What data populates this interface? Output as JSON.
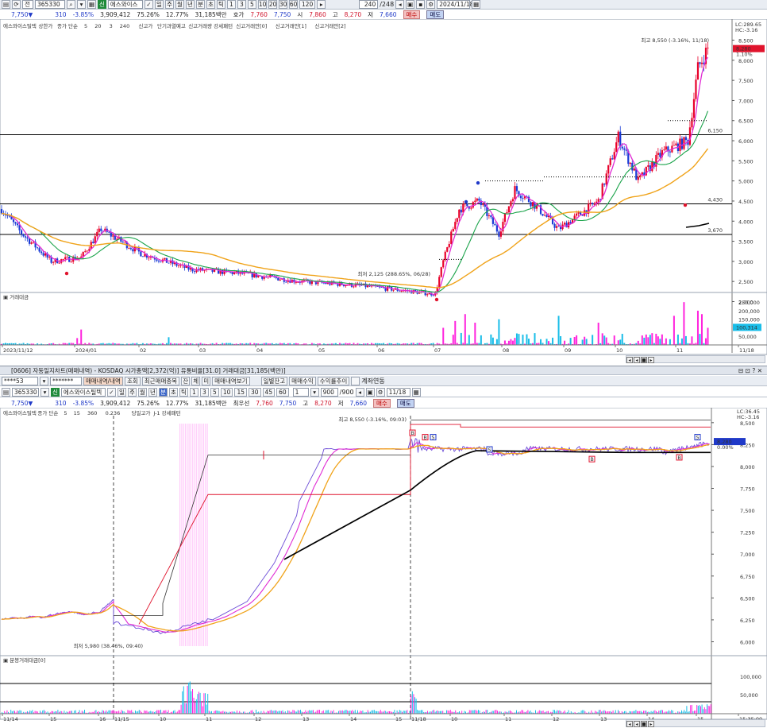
{
  "top": {
    "toolbar": {
      "code": "365330",
      "flag": "전",
      "name": "에스와이스",
      "chk": "주",
      "periods": [
        "일",
        "주",
        "월",
        "년",
        "분",
        "초",
        "틱"
      ],
      "nums": [
        "1",
        "3",
        "5",
        "10",
        "20",
        "30",
        "60",
        "120"
      ],
      "count": "240",
      "total": "/248",
      "date": "2024/11/18"
    },
    "quote": {
      "price": "7,750▼",
      "change": "310",
      "pct": "-3.85%",
      "volume": "3,909,412",
      "ratio": "75.26%",
      "turn": "12.77%",
      "amount": "31,185백만",
      "ask_label": "호가",
      "ask": "7,760",
      "bid": "7,750",
      "high_label": "시",
      "open": "7,860",
      "hi_label": "고",
      "high": "8,270",
      "lo_label": "저",
      "low": "7,660",
      "buy": "매수",
      "sell": "매도"
    },
    "legend": [
      "에스와이스틸텍",
      "상한가",
      "종가 단순",
      "5",
      "20",
      "3",
      "240",
      "신고가",
      "단기과열예고",
      "신고거래량 강세패턴",
      "신고거래안[0]",
      "신고거래안[1]",
      "신고거래안[2]"
    ],
    "price_axis": [
      "8,500",
      "8,000",
      "7,500",
      "7,000",
      "6,500",
      "6,000",
      "5,500",
      "5,000",
      "4,500",
      "4,000",
      "3,500",
      "3,000",
      "2,500",
      "2,000"
    ],
    "levels": [
      "6,150",
      "4,430",
      "3,670"
    ],
    "axis_head": "LC:289.65\nHC:-3.16",
    "current_tag": "8,280",
    "current_sub": "1.10%",
    "high_note": "최고 8,550 (-3.16%, 11/18)",
    "low_note": "최저 2,125 (288.65%, 06/28)",
    "vol_title": "거래대금",
    "vol_axis": [
      "250,000",
      "200,000",
      "150,000",
      "100,000",
      "50,000"
    ],
    "vol_tag": "100,314",
    "dates": [
      "2023/11/12",
      "2024/01",
      "02",
      "03",
      "04",
      "05",
      "06",
      "07",
      "08",
      "09",
      "10",
      "11",
      "11/18"
    ]
  },
  "bottom": {
    "title": "[0606] 자동일지차트(매매내역) - KOSDAQ 시가총액[2,372(억)] 유통비율[31.0] 거래대금[31,185(백만)]",
    "toolbar": {
      "code": "365330",
      "tag": "신",
      "name": "에스와이스틸텍",
      "btn1": "매매내역/내역",
      "btn2": "조회",
      "btn3": "최근매매종목",
      "btn4": "잔",
      "btn5": "체",
      "btn6": "미",
      "btn7": "매매내역보기",
      "btn8": "일별잔고",
      "btn9": "매매수익",
      "btn10": "수익률추이",
      "chk": "계좌연동",
      "periods": [
        "일",
        "주",
        "월",
        "년",
        "분",
        "초",
        "틱"
      ],
      "nums": [
        "1",
        "3",
        "5",
        "10",
        "15",
        "30",
        "45",
        "60"
      ],
      "count": "900",
      "total": "/900",
      "date": "11/18"
    },
    "quote": {
      "price": "7,750▼",
      "change": "310",
      "pct": "-3.85%",
      "volume": "3,909,412",
      "ratio": "75.26%",
      "turn": "12.77%",
      "amount": "31,185백만",
      "ask_label": "최우선",
      "ask": "7,760",
      "bid": "7,750",
      "hi_label": "고",
      "high": "8,270",
      "lo_label": "저",
      "low": "7,660",
      "buy": "매수",
      "sell": "매도"
    },
    "legend": [
      "에스와이스틸텍",
      "종가 단순",
      "5",
      "15",
      "360",
      "0.236",
      "당일고가",
      "J-1 강세패턴"
    ],
    "price_axis": [
      "8,500",
      "8,250",
      "8,000",
      "7,750",
      "7,500",
      "7,250",
      "7,000",
      "6,750",
      "6,500",
      "6,250",
      "6,000"
    ],
    "axis_head": "LC:36.45\nHC:-3.16",
    "current_tag": "8,280",
    "current_sub": "0.00%",
    "high_note": "최고 8,550 (-3.16%, 09:03)",
    "low_note": "최저 5,980 (38.46%, 09:40)",
    "vol_title": "분봉거래대금[0]",
    "vol_axis": [
      "100,000",
      "50,000"
    ],
    "dates": [
      "11/14",
      "15",
      "16",
      "11/15",
      "10",
      "11",
      "12",
      "13",
      "14",
      "15",
      "11/18",
      "10",
      "11",
      "12",
      "13",
      "14",
      "15",
      "15:35:00"
    ]
  },
  "colors": {
    "up": "#e8002a",
    "down": "#1a3bd6",
    "ma5": "#e02bd4",
    "ma20": "#1aa34a",
    "ma60": "#f0a31a",
    "vol_up": "#ff24dd",
    "vol_down": "#19bde8"
  }
}
